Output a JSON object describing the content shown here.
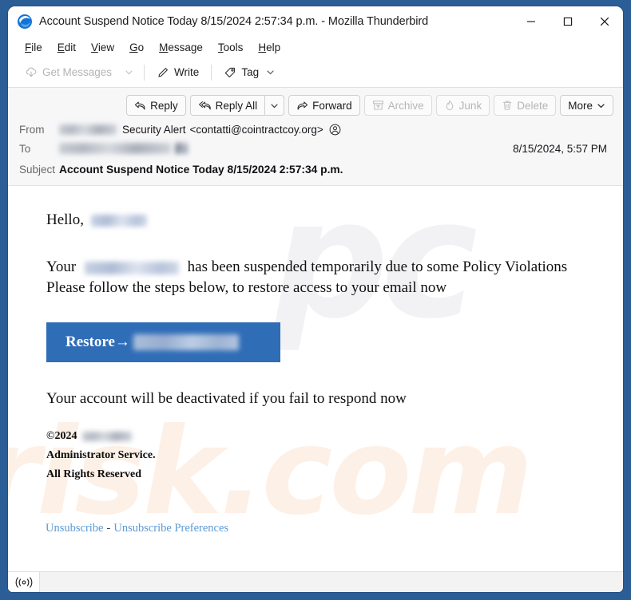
{
  "window": {
    "title": "Account Suspend Notice Today 8/15/2024 2:57:34 p.m. - Mozilla Thunderbird",
    "app_icon": "thunderbird-icon",
    "controls": {
      "minimize": "minimize-icon",
      "maximize": "maximize-icon",
      "close": "close-icon"
    }
  },
  "menubar": {
    "items": [
      {
        "label": "File",
        "accesskey": "F"
      },
      {
        "label": "Edit",
        "accesskey": "E"
      },
      {
        "label": "View",
        "accesskey": "V"
      },
      {
        "label": "Go",
        "accesskey": "G"
      },
      {
        "label": "Message",
        "accesskey": "M"
      },
      {
        "label": "Tools",
        "accesskey": "T"
      },
      {
        "label": "Help",
        "accesskey": "H"
      }
    ]
  },
  "toolbar": {
    "get_messages": "Get Messages",
    "get_messages_enabled": false,
    "write": "Write",
    "tag": "Tag"
  },
  "message_actions": {
    "reply": "Reply",
    "reply_all": "Reply All",
    "forward": "Forward",
    "archive": "Archive",
    "junk": "Junk",
    "delete": "Delete",
    "more": "More",
    "disabled": [
      "Archive",
      "Junk",
      "Delete"
    ]
  },
  "message_header": {
    "from_label": "From",
    "from_name_redacted": true,
    "from_display": "Security Alert",
    "from_address": "<contatti@cointractcoy.org>",
    "to_label": "To",
    "to_redacted": true,
    "date": "8/15/2024, 5:57 PM",
    "subject_label": "Subject",
    "subject": "Account Suspend Notice Today 8/15/2024 2:57:34 p.m."
  },
  "email_body": {
    "greeting": "Hello,",
    "greeting_redacted": true,
    "line1_prefix": "Your",
    "line1_redacted": true,
    "line1_suffix": "has been suspended temporarily due to some Policy Violations",
    "line2": "Please follow the steps below, to restore access to your email now",
    "button_label": "Restore→",
    "button_redacted": true,
    "button_color": "#2f6db7",
    "warning": "Your account will be deactivated if you fail to respond now",
    "copyright": "©2024",
    "copyright_redacted": true,
    "footer_line2": "Administrator Service.",
    "footer_line3": "All Rights Reserved",
    "unsubscribe": "Unsubscribe",
    "unsubscribe_separator": "-",
    "unsubscribe_prefs": "Unsubscribe Preferences",
    "link_color": "#5b9bd5",
    "watermark_top": "pc",
    "watermark_bottom": "risk.com"
  },
  "statusbar": {
    "online_indicator": "((o))"
  }
}
